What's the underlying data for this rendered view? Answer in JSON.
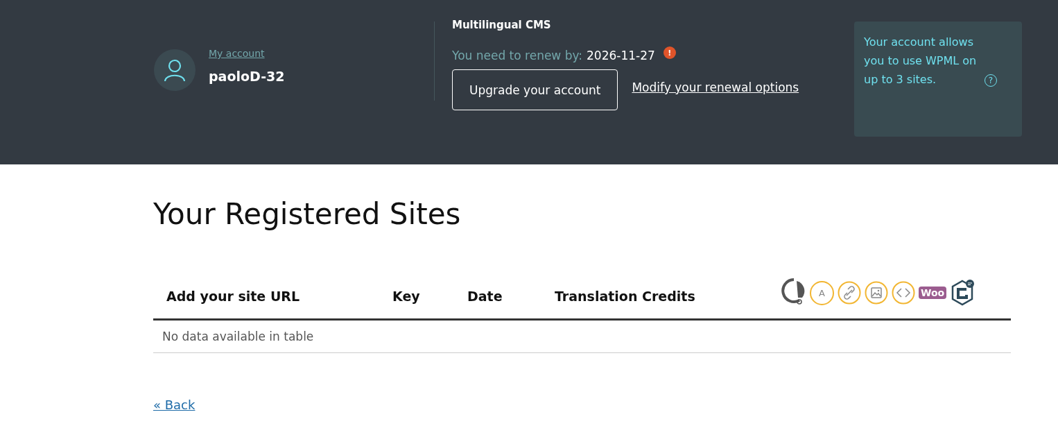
{
  "account": {
    "link": "My account",
    "username": "paoloD-32"
  },
  "subscription": {
    "product": "Multilingual CMS",
    "renew_label": "You need to renew by:",
    "renew_date": "2026-11-27",
    "warning": "!",
    "upgrade_button": "Upgrade your account",
    "modify_link": "Modify your renewal options"
  },
  "allowance": {
    "text": "Your account allows you to use WPML on up to 3 sites.",
    "help": "?"
  },
  "page_title": "Your Registered Sites",
  "table": {
    "columns": [
      "Add your site URL",
      "Key",
      "Date",
      "Translation Credits"
    ],
    "icon_letters": {
      "translate": "A",
      "woo": "Woo"
    },
    "empty_message": "No data available in table"
  },
  "back_link": "« Back"
}
